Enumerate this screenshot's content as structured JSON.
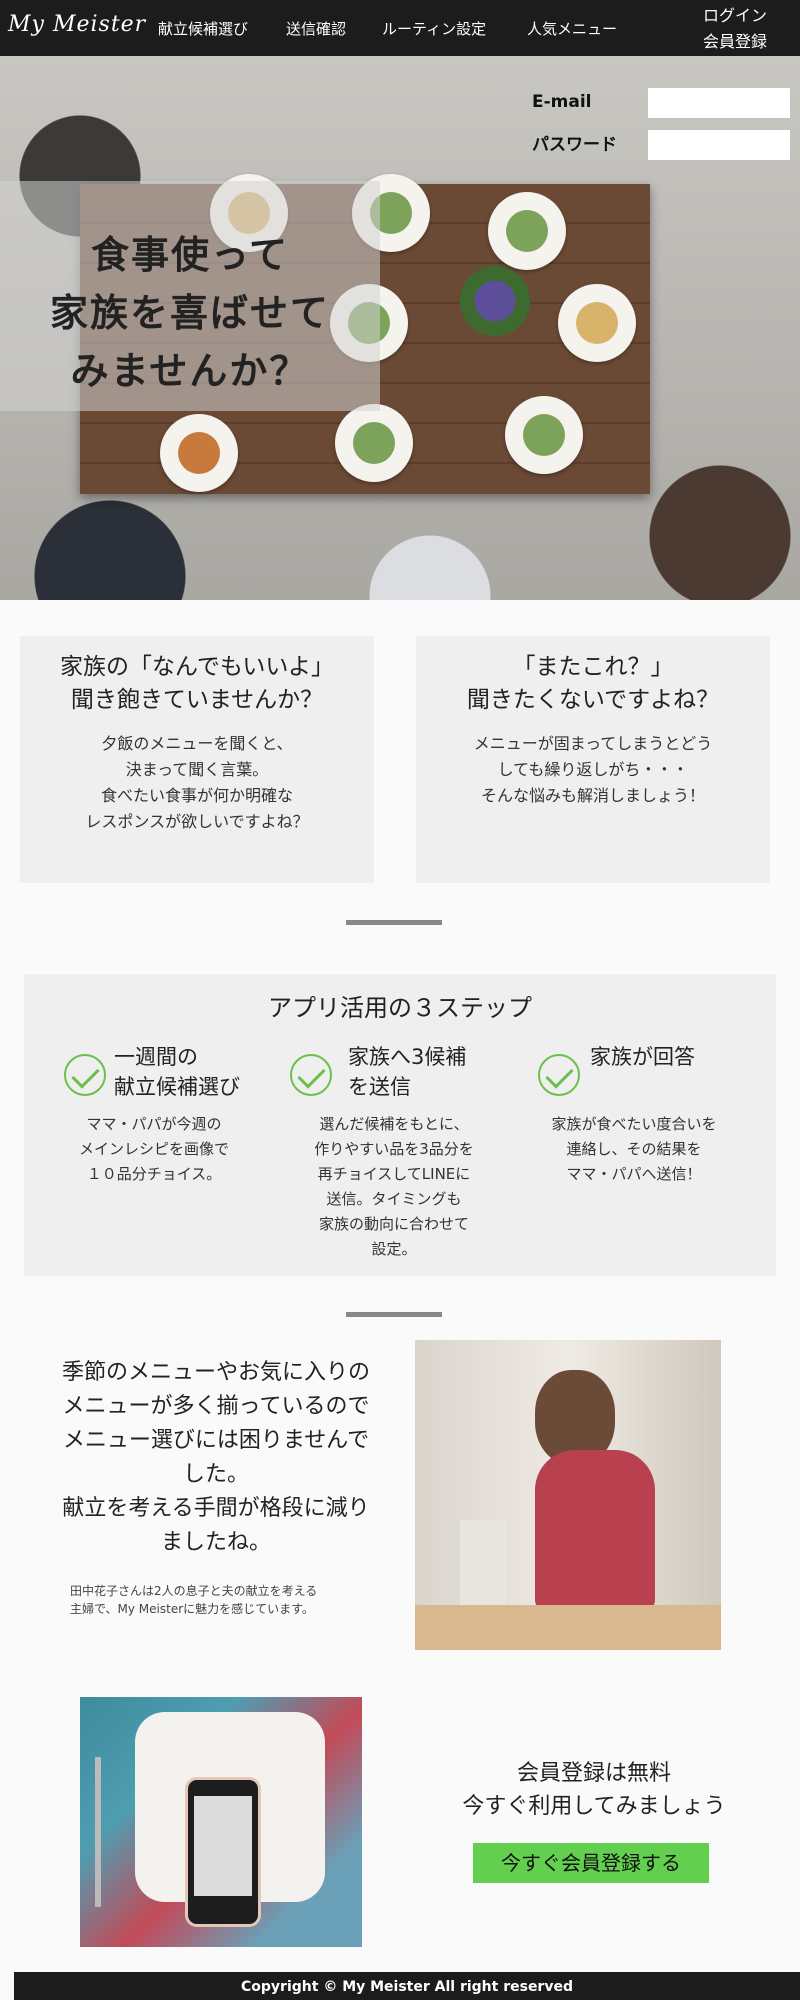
{
  "header": {
    "logo": "My Meister",
    "nav": [
      "献立候補選び",
      "送信確認",
      "ルーティン設定",
      "人気メニュー"
    ],
    "login": "ログイン",
    "register": "会員登録"
  },
  "hero": {
    "headline": [
      "食事使って",
      "家族を喜ばせて",
      "みませんか？"
    ],
    "email_label": "E-mail",
    "password_label": "パスワード"
  },
  "problems": [
    {
      "title": "家族の「なんでもいいよ」\n聞き飽きていませんか？",
      "body": "夕飯のメニューを聞くと、\n決まって聞く言葉。\n食べたい食事が何か明確な\nレスポンスが欲しいですよね？"
    },
    {
      "title": "「またこれ？」\n聞きたくないですよね？",
      "body": "メニューが固まってしまうとどう\nしても繰り返しがち・・・\nそんな悩みも解消しましょう！"
    }
  ],
  "steps": {
    "title": "アプリ活用の３ステップ",
    "items": [
      {
        "title": "一週間の\n献立候補選び",
        "desc": "ママ・パパが今週の\nメインレシピを画像で\n１０品分チョイス。"
      },
      {
        "title": "家族へ3候補\nを送信",
        "desc": "選んだ候補をもとに、\n作りやすい品を3品分を\n再チョイスしてLINEに\n送信。タイミングも\n家族の動向に合わせて\n設定。"
      },
      {
        "title": "家族が回答",
        "desc": "家族が食べたい度合いを\n連絡し、その結果を\nママ・パパへ送信！"
      }
    ]
  },
  "testimonial": {
    "quote": "季節のメニューやお気に入りのメニューが多く揃っているのでメニュー選びには困りませんでした。\n献立を考える手間が格段に減りましたね。",
    "note": "田中花子さんは2人の息子と夫の献立を考える\n主婦で、My Meisterに魅力を感じています。"
  },
  "cta": {
    "text": "会員登録は無料\n今すぐ利用してみましょう",
    "button": "今すぐ会員登録する"
  },
  "footer": {
    "copyright": "Copyright © My Meister All right reserved"
  },
  "colors": {
    "header_bg": "#1c1c1c",
    "accent_green": "#62d04e",
    "card_bg": "#efefef"
  }
}
